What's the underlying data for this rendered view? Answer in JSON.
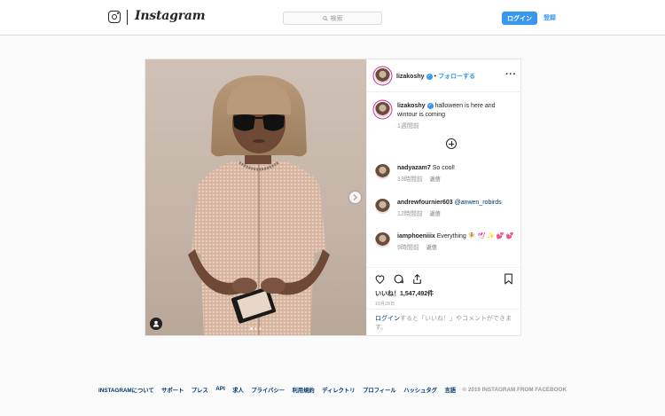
{
  "header": {
    "brand": "Instagram",
    "search_placeholder": "検索",
    "login_label": "ログイン",
    "signup_label": "登録"
  },
  "post": {
    "username": "lizakoshy",
    "follow_label": "フォローする",
    "caption": "halloween is here and wintour is coming",
    "caption_time": "1週間前",
    "likes": "いいね！1,547,492件",
    "date": "10月28日",
    "login_prompt_link": "ログイン",
    "login_prompt_rest": "すると「いいね！」やコメントができます。"
  },
  "comments": [
    {
      "username": "nadyazam7",
      "text": "So cool!",
      "mention": "",
      "time": "13時間前",
      "reply": "返信"
    },
    {
      "username": "andrewfournier603",
      "text": "",
      "mention": "@anwen_robirds",
      "time": "12時間前",
      "reply": "返信"
    },
    {
      "username": "iamphoeniiix",
      "text": "Everything",
      "mention": "",
      "emoji": "🧚 🕊 ✨ 💕 💕",
      "time": "9時間前",
      "reply": "返信"
    }
  ],
  "footer": {
    "links": [
      "INSTAGRAMについて",
      "サポート",
      "プレス",
      "API",
      "求人",
      "プライバシー",
      "利用規約",
      "ディレクトリ",
      "プロフィール",
      "ハッシュタグ",
      "言語"
    ],
    "copyright": "© 2019 INSTAGRAM FROM FACEBOOK"
  },
  "colors": {
    "accent": "#3897f0",
    "link_dark": "#003569",
    "muted": "#999999"
  }
}
